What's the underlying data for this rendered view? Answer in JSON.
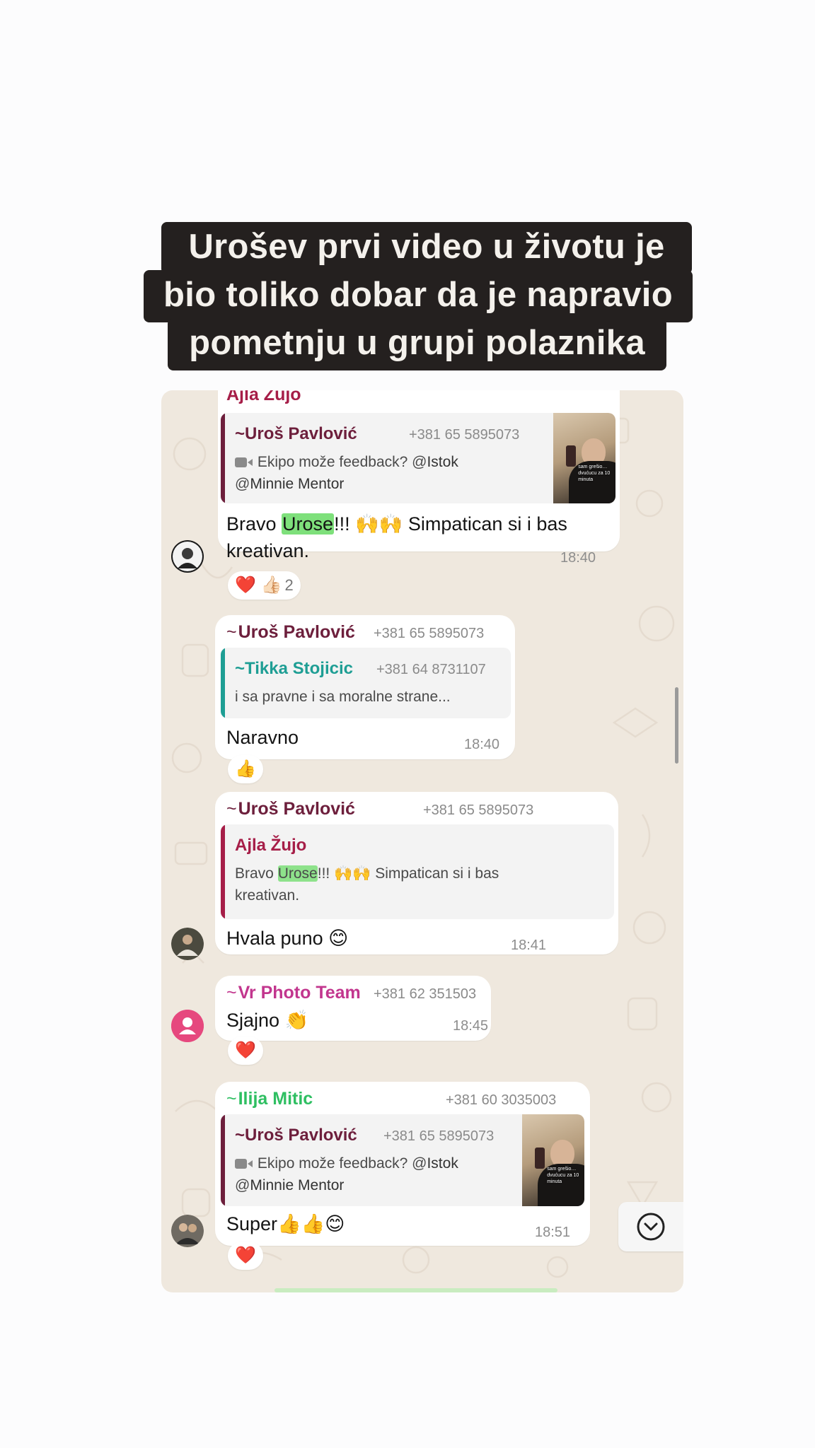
{
  "story": {
    "caption_lines": [
      "Urošev prvi video u životu je",
      "bio toliko dobar da je napravio",
      "pometnju u grupi polaznika"
    ]
  },
  "colors": {
    "ajla": "#a61e48",
    "uros": "#6d1f3c",
    "tikka": "#1e9e94",
    "vr_photo": "#c2368e",
    "ilija": "#2fbf62",
    "highlight": "#7ee07b"
  },
  "chat": {
    "messages": [
      {
        "sender": "Ajla Žujo",
        "quote": {
          "tilde": "~",
          "sender": "Uroš Pavlović",
          "phone": "+381 65 5895073",
          "icon": "video-camera-icon",
          "text_prefix": "Ekipo može feedback? @",
          "mention1": "Istok",
          "text_line2_prefix": "@",
          "mention2": "Minnie Mentor",
          "thumb_text": "sam grešio… dvućucu za 10 minuta"
        },
        "text_before": "Bravo ",
        "highlight": "Urose",
        "text_after": "!!! 🙌🙌 Simpatican si i bas",
        "text_line2": "kreativan.",
        "time": "18:40",
        "reactions": "❤️ 👍🏻",
        "reaction_count": "2"
      },
      {
        "tilde": "~",
        "sender": "Uroš Pavlović",
        "phone": "+381 65 5895073",
        "quote": {
          "tilde": "~",
          "sender": "Tikka Stojicic",
          "phone": "+381 64 8731107",
          "text": "i sa pravne i sa moralne strane..."
        },
        "text": "Naravno",
        "time": "18:40",
        "reactions": "👍"
      },
      {
        "tilde": "~",
        "sender": "Uroš Pavlović",
        "phone": "+381 65 5895073",
        "quote": {
          "sender": "Ajla Žujo",
          "text_before": "Bravo ",
          "highlight": "Urose",
          "text_after": "!!! 🙌🙌 Simpatican si i bas",
          "text_line2": "kreativan."
        },
        "text": "Hvala puno 😊",
        "time": "18:41"
      },
      {
        "tilde": "~",
        "sender": "Vr Photo Team",
        "phone": "+381 62 351503",
        "text": "Sjajno 👏",
        "time": "18:45",
        "reactions": "❤️"
      },
      {
        "tilde": "~",
        "sender": "Ilija Mitic",
        "phone": "+381 60 3035003",
        "quote": {
          "tilde": "~",
          "sender": "Uroš Pavlović",
          "phone": "+381 65 5895073",
          "icon": "video-camera-icon",
          "text_prefix": "Ekipo može feedback? @",
          "mention1": "Istok",
          "text_line2_prefix": "@",
          "mention2": "Minnie Mentor",
          "thumb_text": "sam grešio… dvućucu za 10 minuta"
        },
        "text": "Super👍👍😊",
        "time": "18:51",
        "reactions": "❤️"
      }
    ],
    "scroll_down_icon": "chevron-down-circle-icon"
  }
}
